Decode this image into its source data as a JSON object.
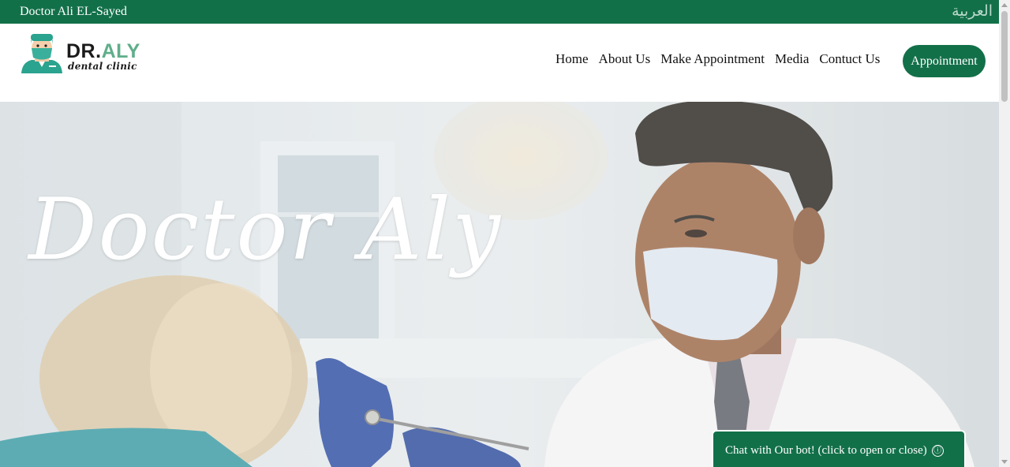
{
  "topbar": {
    "site_name": "Doctor Ali EL-Sayed",
    "language_link": "العربية"
  },
  "logo": {
    "brand_prefix": "DR.",
    "brand_accent": "ALY",
    "brand_sub": "dental clinic",
    "icon": "dentist-avatar-icon"
  },
  "nav": {
    "items": [
      {
        "label": "Home"
      },
      {
        "label": "About Us"
      },
      {
        "label": "Make Appointment"
      },
      {
        "label": "Media"
      },
      {
        "label": "Contuct Us"
      }
    ],
    "cta_label": "Appointment"
  },
  "hero": {
    "title": "Doctor Aly",
    "image": "dentist-examining-patient-photo"
  },
  "chat": {
    "label": "Chat with Our bot! (click to open or close)",
    "info_icon": "ⓘ"
  },
  "colors": {
    "brand_green": "#127049",
    "accent_green": "#5fae8a",
    "white": "#ffffff"
  }
}
